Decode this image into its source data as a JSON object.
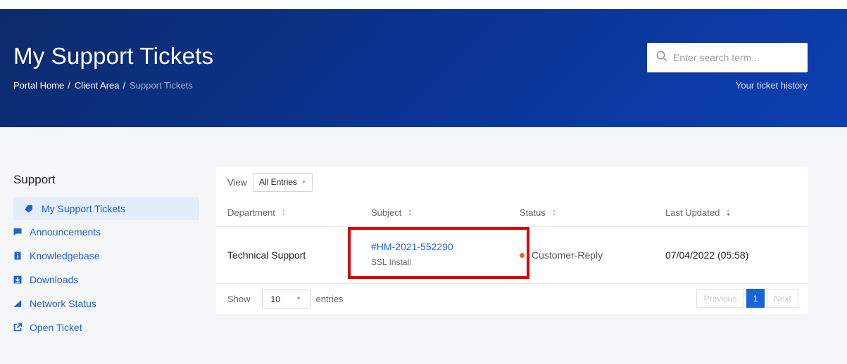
{
  "header": {
    "title": "My Support Tickets",
    "breadcrumb": [
      {
        "label": "Portal Home"
      },
      {
        "label": "Client Area"
      },
      {
        "label": "Support Tickets"
      }
    ],
    "breadcrumb_separator": "/",
    "search": {
      "placeholder": "Enter search term..."
    },
    "history_link": "Your ticket history"
  },
  "sidebar": {
    "heading": "Support",
    "items": [
      {
        "label": "My Support Tickets",
        "icon": "ticket-icon",
        "active": true
      },
      {
        "label": "Announcements",
        "icon": "flag-icon",
        "active": false
      },
      {
        "label": "Knowledgebase",
        "icon": "info-icon",
        "active": false
      },
      {
        "label": "Downloads",
        "icon": "download-icon",
        "active": false
      },
      {
        "label": "Network Status",
        "icon": "signal-icon",
        "active": false
      },
      {
        "label": "Open Ticket",
        "icon": "external-link-icon",
        "active": false
      }
    ]
  },
  "table": {
    "view_label": "View",
    "view_selected": "All Entries",
    "columns": [
      "Department",
      "Subject",
      "Status",
      "Last Updated"
    ],
    "rows": [
      {
        "department": "Technical Support",
        "ticket_id": "#HM-2021-552290",
        "subject": "SSL Install",
        "status": "Customer-Reply",
        "last_updated": "07/04/2022 (05:58)"
      }
    ],
    "show_label": "Show",
    "show_value": "10",
    "entries_label": "entries",
    "pagination": {
      "previous": "Previous",
      "current": "1",
      "next": "Next"
    }
  },
  "colors": {
    "accent": "#1a63d8",
    "hero_dark": "#0d2b6b",
    "status_customer_reply": "#f26522",
    "highlight": "#d90000"
  }
}
